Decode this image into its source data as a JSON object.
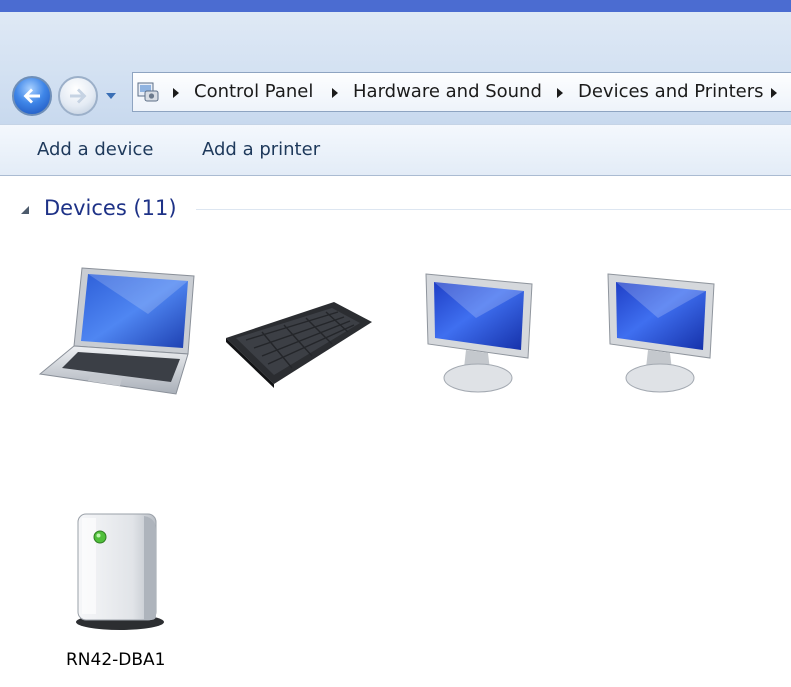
{
  "navigation": {
    "back_icon": "back-arrow-icon",
    "forward_icon": "forward-arrow-icon",
    "breadcrumbs": [
      "Control Panel",
      "Hardware and Sound",
      "Devices and Printers"
    ]
  },
  "toolbar": {
    "add_device_label": "Add a device",
    "add_printer_label": "Add a printer"
  },
  "devices_group": {
    "title": "Devices (11)",
    "items": [
      {
        "icon": "laptop-icon",
        "label": ""
      },
      {
        "icon": "keyboard-icon",
        "label": ""
      },
      {
        "icon": "monitor-icon",
        "label": ""
      },
      {
        "icon": "monitor-icon",
        "label": ""
      },
      {
        "icon": "generic-device-icon",
        "label": "RN42-DBA1"
      }
    ]
  },
  "colors": {
    "title_bar": "#4b6cd1",
    "chrome": "#d3e1f2",
    "group_title": "#1e3287",
    "link_text": "#1e395b"
  }
}
